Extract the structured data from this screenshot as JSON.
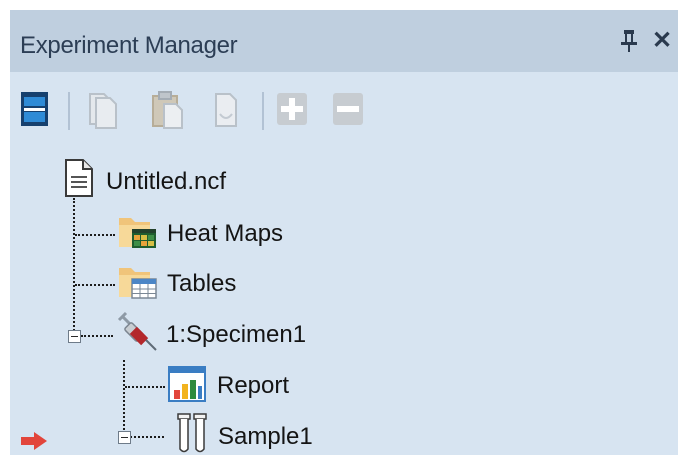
{
  "panel": {
    "title": "Experiment Manager"
  },
  "toolbar": {
    "buttons": [
      "view-toggle-icon",
      "cut-icon",
      "paste-icon",
      "copy-icon",
      "add-icon",
      "remove-icon"
    ]
  },
  "tree": {
    "root": "Untitled.ncf",
    "heat_maps": "Heat Maps",
    "tables": "Tables",
    "specimen": "1:Specimen1",
    "report": "Report",
    "sample": "Sample1"
  },
  "colors": {
    "panel_bg": "#d7e4f1",
    "title_bg": "#bfcfdf",
    "current_arrow": "#e2453b"
  }
}
